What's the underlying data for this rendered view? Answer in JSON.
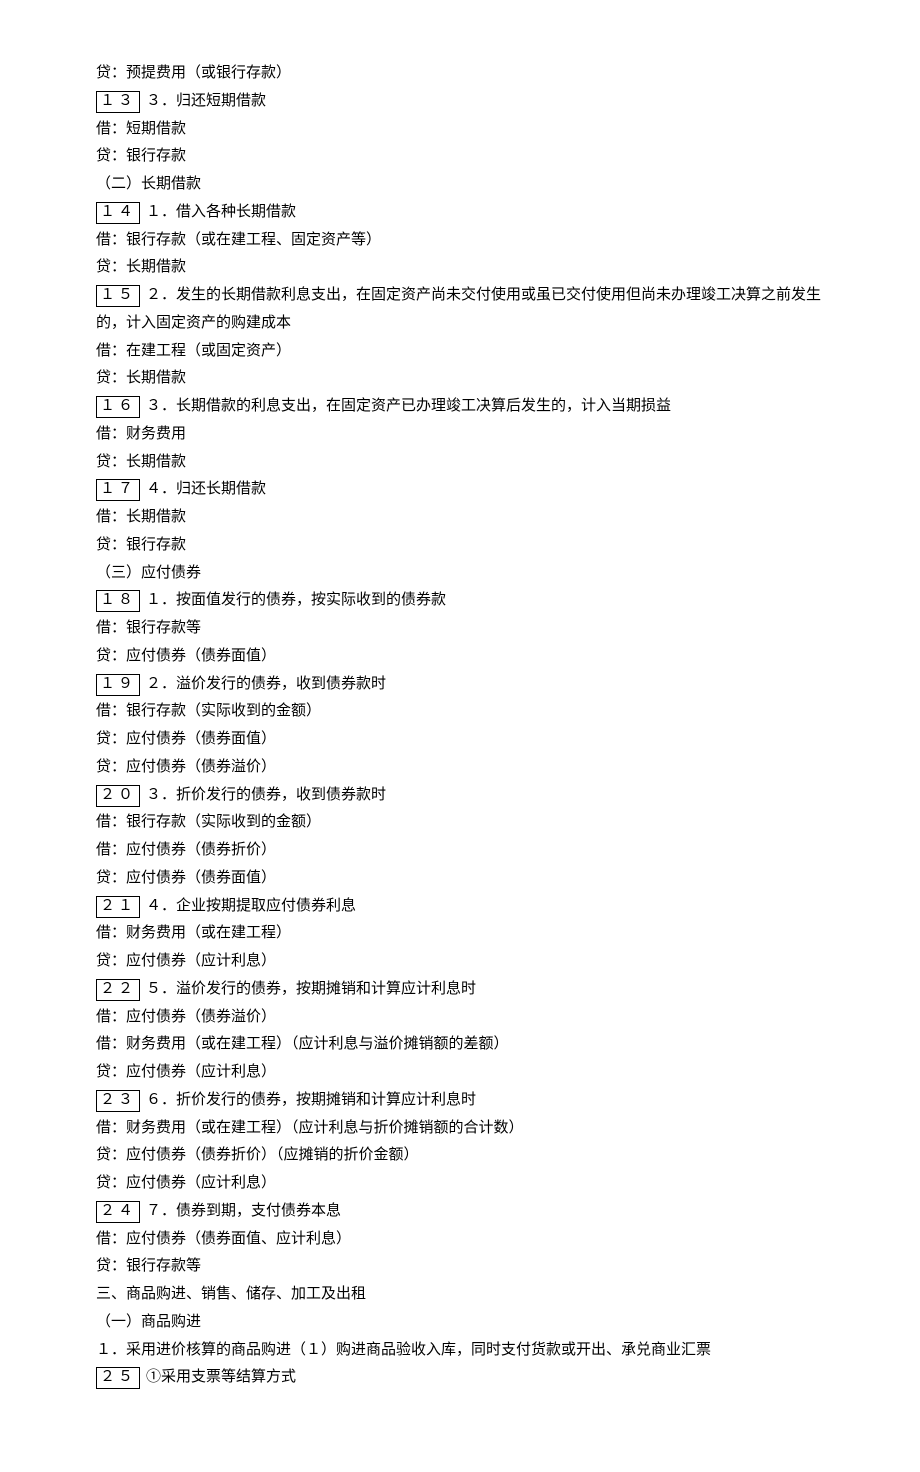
{
  "lines": [
    {
      "text": "贷：预提费用（或银行存款）"
    },
    {
      "box": "１３",
      "text": "３．归还短期借款"
    },
    {
      "text": "借：短期借款"
    },
    {
      "text": "贷：银行存款"
    },
    {
      "text": "（二）长期借款"
    },
    {
      "box": "１４",
      "text": "１．借入各种长期借款"
    },
    {
      "text": "借：银行存款（或在建工程、固定资产等）"
    },
    {
      "text": "贷：长期借款"
    },
    {
      "box": "１５",
      "text": "２．发生的长期借款利息支出，在固定资产尚未交付使用或虽已交付使用但尚未办理竣工决算之前发生的，计入固定资产的购建成本"
    },
    {
      "text": "借：在建工程（或固定资产）"
    },
    {
      "text": "贷：长期借款"
    },
    {
      "box": "１６",
      "text": "３．长期借款的利息支出，在固定资产已办理竣工决算后发生的，计入当期损益"
    },
    {
      "text": "借：财务费用"
    },
    {
      "text": "贷：长期借款"
    },
    {
      "box": "１７",
      "text": "４．归还长期借款"
    },
    {
      "text": "借：长期借款"
    },
    {
      "text": "贷：银行存款"
    },
    {
      "text": "（三）应付债券"
    },
    {
      "box": "１８",
      "text": "１．按面值发行的债券，按实际收到的债券款"
    },
    {
      "text": "借：银行存款等"
    },
    {
      "text": "贷：应付债券（债券面值）"
    },
    {
      "box": "１９",
      "text": "２．溢价发行的债券，收到债券款时"
    },
    {
      "text": "借：银行存款（实际收到的金额）"
    },
    {
      "text": "贷：应付债券（债券面值）"
    },
    {
      "text": "贷：应付债券（债券溢价）"
    },
    {
      "box": "２０",
      "text": "３．折价发行的债券，收到债券款时"
    },
    {
      "text": "借：银行存款（实际收到的金额）"
    },
    {
      "text": "借：应付债券（债券折价）"
    },
    {
      "text": "贷：应付债券（债券面值）"
    },
    {
      "box": "２１",
      "text": "４．企业按期提取应付债券利息"
    },
    {
      "text": "借：财务费用（或在建工程）"
    },
    {
      "text": "贷：应付债券（应计利息）"
    },
    {
      "box": "２２",
      "text": "５．溢价发行的债券，按期摊销和计算应计利息时"
    },
    {
      "text": "借：应付债券（债券溢价）"
    },
    {
      "text": "借：财务费用（或在建工程）（应计利息与溢价摊销额的差额）"
    },
    {
      "text": "贷：应付债券（应计利息）"
    },
    {
      "box": "２３",
      "text": "６．折价发行的债券，按期摊销和计算应计利息时"
    },
    {
      "text": "借：财务费用（或在建工程）（应计利息与折价摊销额的合计数）"
    },
    {
      "text": "贷：应付债券（债券折价）（应摊销的折价金额）"
    },
    {
      "text": "贷：应付债券（应计利息）"
    },
    {
      "box": "２４",
      "text": "７．债券到期，支付债券本息"
    },
    {
      "text": "借：应付债券（债券面值、应计利息）"
    },
    {
      "text": "贷：银行存款等"
    },
    {
      "text": "三、商品购进、销售、储存、加工及出租"
    },
    {
      "text": "（一）商品购进"
    },
    {
      "text": "１．采用进价核算的商品购进（１）购进商品验收入库，同时支付货款或开出、承兑商业汇票"
    },
    {
      "box": "２５",
      "text": "①采用支票等结算方式"
    }
  ]
}
